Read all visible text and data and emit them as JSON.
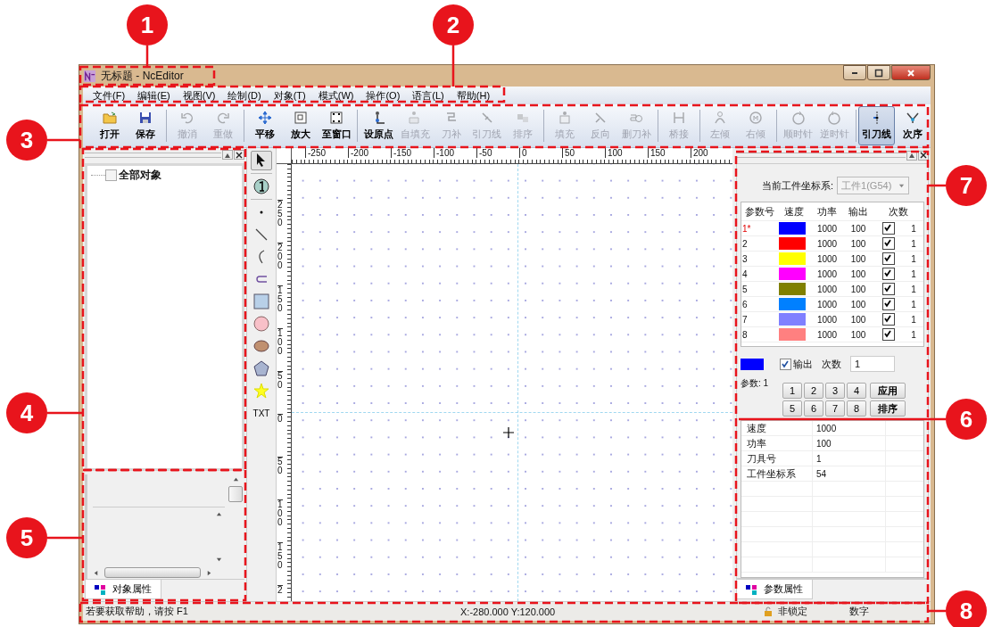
{
  "callouts": [
    {
      "number": "1"
    },
    {
      "number": "2"
    },
    {
      "number": "3"
    },
    {
      "number": "4"
    },
    {
      "number": "5"
    },
    {
      "number": "7"
    },
    {
      "number": "6"
    },
    {
      "number": "8"
    }
  ],
  "window": {
    "title": "无标题 - NcEditor"
  },
  "menu": [
    {
      "label": "文件(F)"
    },
    {
      "label": "编辑(E)"
    },
    {
      "label": "视图(V)"
    },
    {
      "label": "绘制(D)"
    },
    {
      "label": "对象(T)"
    },
    {
      "label": "模式(W)"
    },
    {
      "label": "操作(O)"
    },
    {
      "label": "语言(L)"
    },
    {
      "label": "帮助(H)"
    }
  ],
  "toolbar": [
    {
      "buttons": [
        {
          "label": "打开",
          "disabled": false,
          "selected": false
        },
        {
          "label": "保存",
          "disabled": false,
          "selected": false
        }
      ]
    },
    {
      "buttons": [
        {
          "label": "撤消",
          "disabled": true,
          "selected": false
        },
        {
          "label": "重做",
          "disabled": true,
          "selected": false
        }
      ]
    },
    {
      "buttons": [
        {
          "label": "平移",
          "disabled": false,
          "selected": false
        },
        {
          "label": "放大",
          "disabled": false,
          "selected": false
        },
        {
          "label": "至窗口",
          "disabled": false,
          "selected": false
        }
      ]
    },
    {
      "buttons": [
        {
          "label": "设原点",
          "disabled": false,
          "selected": false
        },
        {
          "label": "自填充",
          "disabled": true,
          "selected": false
        },
        {
          "label": "刀补",
          "disabled": true,
          "selected": false
        },
        {
          "label": "引刀线",
          "disabled": true,
          "selected": false
        },
        {
          "label": "排序",
          "disabled": true,
          "selected": false
        }
      ]
    },
    {
      "buttons": [
        {
          "label": "填充",
          "disabled": true,
          "selected": false
        },
        {
          "label": "反向",
          "disabled": true,
          "selected": false
        },
        {
          "label": "删刀补",
          "disabled": true,
          "selected": false
        }
      ]
    },
    {
      "buttons": [
        {
          "label": "桥接",
          "disabled": true,
          "selected": false
        }
      ]
    },
    {
      "buttons": [
        {
          "label": "左倾",
          "disabled": true,
          "selected": false
        },
        {
          "label": "右倾",
          "disabled": true,
          "selected": false
        }
      ]
    },
    {
      "buttons": [
        {
          "label": "顺时针",
          "disabled": true,
          "selected": false
        },
        {
          "label": "逆时针",
          "disabled": true,
          "selected": false
        }
      ]
    },
    {
      "buttons": [
        {
          "label": "引刀线",
          "disabled": false,
          "selected": true
        },
        {
          "label": "次序",
          "disabled": false,
          "selected": false
        }
      ]
    }
  ],
  "left_panel": {
    "tree": [
      {
        "label": "全部对象",
        "checked": false
      }
    ],
    "tab": {
      "label": "对象属性",
      "selected": true
    }
  },
  "tools": [
    {
      "selected": true
    },
    {
      "selected": false
    },
    {
      "selected": false
    },
    {
      "selected": false
    },
    {
      "selected": false
    },
    {
      "selected": false
    },
    {
      "selected": false
    },
    {
      "selected": false
    },
    {
      "selected": false
    },
    {
      "selected": false
    },
    {
      "selected": false
    },
    {
      "selected": false,
      "label": "TXT"
    }
  ],
  "ruler": {
    "horizontal": [
      "-250",
      "-200",
      "-150",
      "-100",
      "-50",
      "0",
      "50",
      "100",
      "150",
      "200"
    ],
    "vertical": [
      "250",
      "200",
      "150",
      "100",
      "50",
      "0",
      "50",
      "100",
      "150",
      "2"
    ]
  },
  "right_panel": {
    "coord_label": "当前工件坐标系:",
    "coord_select": {
      "value": "工件1(G54)",
      "disabled": true
    },
    "params": {
      "columns": [
        "参数号",
        "速度",
        "功率",
        "输出",
        "次数"
      ],
      "rows": [
        {
          "number": "1*",
          "selected": true,
          "color": "#0000ff",
          "speed": "1000",
          "power": "100",
          "output": true,
          "count": "1"
        },
        {
          "number": "2",
          "selected": false,
          "color": "#ff0000",
          "speed": "1000",
          "power": "100",
          "output": true,
          "count": "1"
        },
        {
          "number": "3",
          "selected": false,
          "color": "#ffff00",
          "speed": "1000",
          "power": "100",
          "output": true,
          "count": "1"
        },
        {
          "number": "4",
          "selected": false,
          "color": "#ff00ff",
          "speed": "1000",
          "power": "100",
          "output": true,
          "count": "1"
        },
        {
          "number": "5",
          "selected": false,
          "color": "#808000",
          "speed": "1000",
          "power": "100",
          "output": true,
          "count": "1"
        },
        {
          "number": "6",
          "selected": false,
          "color": "#0080ff",
          "speed": "1000",
          "power": "100",
          "output": true,
          "count": "1"
        },
        {
          "number": "7",
          "selected": false,
          "color": "#8080ff",
          "speed": "1000",
          "power": "100",
          "output": true,
          "count": "1"
        },
        {
          "number": "8",
          "selected": false,
          "color": "#ff8080",
          "speed": "1000",
          "power": "100",
          "output": true,
          "count": "1"
        }
      ]
    },
    "current": {
      "color": "#0000ff",
      "output": {
        "label": "输出",
        "checked": true
      },
      "count_label": "次数",
      "count_value": "1",
      "param_label": "参数: 1"
    },
    "number_buttons": [
      "1",
      "2",
      "3",
      "4",
      "5",
      "6",
      "7",
      "8"
    ],
    "apply_button": "应用",
    "sort_button": "排序",
    "properties": [
      {
        "name": "速度",
        "value": "1000"
      },
      {
        "name": "功率",
        "value": "100"
      },
      {
        "name": "刀具号",
        "value": "1"
      },
      {
        "name": "工件坐标系",
        "value": "54"
      }
    ],
    "tab": {
      "label": "参数属性",
      "selected": true
    }
  },
  "status_bar": {
    "help": "若要获取帮助，请按 F1",
    "coords": "X:-280.000  Y:120.000",
    "lock": "非锁定",
    "num": "数字"
  }
}
